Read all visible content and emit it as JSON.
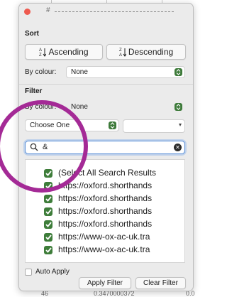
{
  "sheet": {
    "bottom_left": "46",
    "bottom_mid": "0.3470000372",
    "bottom_right": "0.0"
  },
  "panel": {
    "header_text": "#",
    "sort": {
      "title": "Sort",
      "ascending_label": "Ascending",
      "descending_label": "Descending",
      "by_colour_label": "By colour:",
      "by_colour_value": "None"
    },
    "filter": {
      "title": "Filter",
      "by_colour_label": "By colour:",
      "by_colour_value": "None",
      "condition_value": "Choose One",
      "condition_value2": "",
      "search_value": "&",
      "items": [
        "(Select All Search Results",
        "https://oxford.shorthands",
        "https://oxford.shorthands",
        "https://oxford.shorthands",
        "https://oxford.shorthands",
        "https://www-ox-ac-uk.tra",
        "https://www-ox-ac-uk.tra"
      ],
      "auto_apply_label": "Auto Apply",
      "apply_label": "Apply Filter",
      "clear_label": "Clear Filter"
    }
  },
  "colors": {
    "accent_green": "#3e7d3a",
    "annotation_ring": "#a42a96",
    "close_red": "#ee5a4f"
  }
}
